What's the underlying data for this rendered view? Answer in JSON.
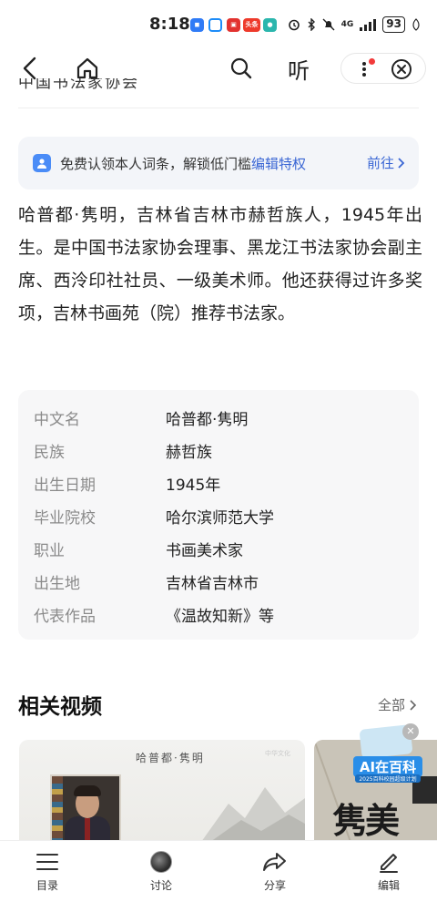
{
  "status_bar": {
    "time": "8:18",
    "network": "4G",
    "battery": "93",
    "app_icon_labels": [
      "头条"
    ]
  },
  "nav": {
    "listen_label": "听"
  },
  "top_cut_text": "中国书法家协会",
  "claim_banner": {
    "text": "免费认领本人词条，解锁低门槛",
    "highlight": "编辑特权",
    "action": "前往"
  },
  "summary": "哈普都·隽明，吉林省吉林市赫哲族人，1945年出生。是中国书法家协会理事、黑龙江书法家协会副主席、西泠印社社员、一级美术师。他还获得过许多奖项，吉林书画苑（院）推荐书法家。",
  "infobox": [
    {
      "key": "中文名",
      "value": "哈普都·隽明"
    },
    {
      "key": "民族",
      "value": "赫哲族"
    },
    {
      "key": "出生日期",
      "value": "1945年"
    },
    {
      "key": "毕业院校",
      "value": "哈尔滨师范大学"
    },
    {
      "key": "职业",
      "value": "书画美术家"
    },
    {
      "key": "出生地",
      "value": "吉林省吉林市"
    },
    {
      "key": "代表作品",
      "value": "《温故知新》等"
    }
  ],
  "related_videos": {
    "title": "相关视频",
    "all_label": "全部",
    "videos": [
      {
        "caption": "哈普都·隽明",
        "watermark": "中华文化"
      },
      {
        "caption": "隽美"
      }
    ]
  },
  "ai_promo": {
    "label": "AI在百科",
    "sub": "2025百科校园超级计划"
  },
  "bottom_bar": {
    "items": [
      {
        "label": "目录",
        "icon": "menu-icon"
      },
      {
        "label": "讨论",
        "icon": "avatar-icon"
      },
      {
        "label": "分享",
        "icon": "share-icon"
      },
      {
        "label": "编辑",
        "icon": "edit-icon"
      }
    ]
  },
  "colors": {
    "accent": "#3a66d4",
    "banner_bg": "#f3f5f9",
    "infobox_bg": "#f7f7f8",
    "notification_dot": "#f23a3a"
  }
}
